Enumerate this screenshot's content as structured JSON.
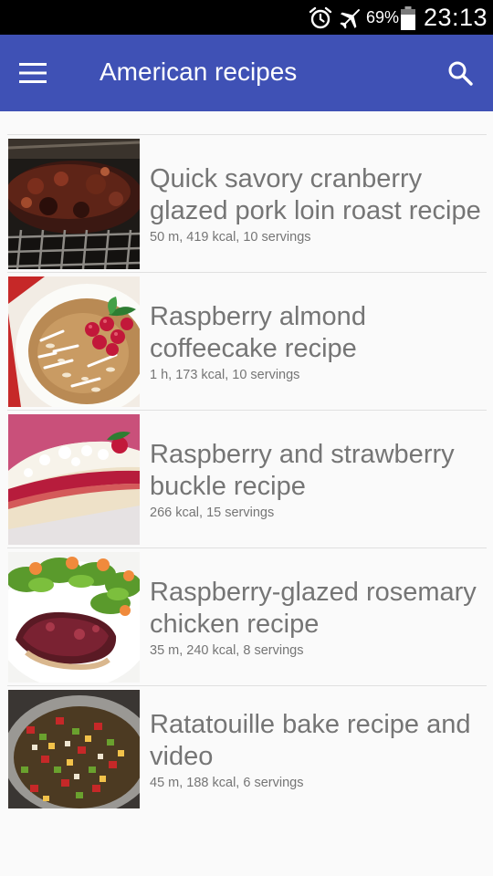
{
  "status_bar": {
    "battery_percent": "69%",
    "time": "23:13",
    "icons": [
      "alarm-icon",
      "airplane-mode-icon",
      "battery-icon"
    ]
  },
  "app_bar": {
    "title": "American recipes",
    "color": "#3f51b5",
    "icons": [
      "menu-icon",
      "search-icon"
    ]
  },
  "recipes": [
    {
      "name": "Quick savory cranberry glazed pork loin roast recipe",
      "meta": "50 m, 419 kcal, 10 servings"
    },
    {
      "name": "Raspberry almond coffeecake recipe",
      "meta": "1 h, 173 kcal, 10 servings"
    },
    {
      "name": "Raspberry and strawberry buckle recipe",
      "meta": "266 kcal, 15 servings"
    },
    {
      "name": "Raspberry-glazed rosemary chicken recipe",
      "meta": "35 m, 240 kcal, 8 servings"
    },
    {
      "name": "Ratatouille bake recipe and video",
      "meta": "45 m, 188 kcal, 6 servings"
    }
  ]
}
